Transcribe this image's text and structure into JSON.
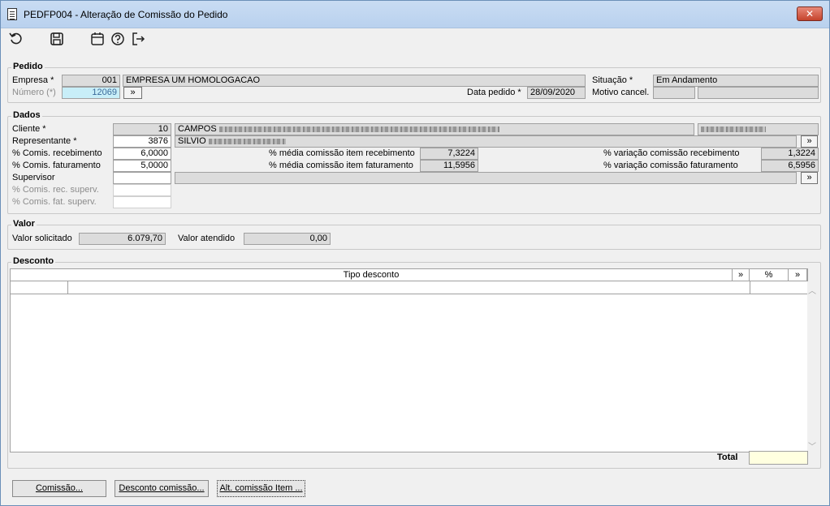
{
  "window": {
    "title": "PEDFP004 - Alteração de Comissão do Pedido",
    "close_label": "✕"
  },
  "toolbar": {
    "undo_icon": "undo-icon",
    "save_icon": "save-icon",
    "calendar_icon": "calendar-icon",
    "help_icon": "help-icon",
    "exit_icon": "exit-icon"
  },
  "pedido": {
    "legend": "Pedido",
    "empresa_label": "Empresa *",
    "empresa_code": "001",
    "empresa_name": "EMPRESA UM HOMOLOGACAO",
    "numero_label": "Número (*)",
    "numero_value": "12069",
    "lookup_label": "»",
    "data_label": "Data pedido *",
    "data_value": "28/09/2020",
    "situacao_label": "Situação *",
    "situacao_value": "Em Andamento",
    "motivo_label": "Motivo cancel."
  },
  "dados": {
    "legend": "Dados",
    "cliente_label": "Cliente *",
    "cliente_code": "10",
    "cliente_name": "CAMPOS",
    "representante_label": "Representante *",
    "representante_code": "3876",
    "representante_name": "SILVIO",
    "comis_receb_label": "% Comis. recebimento",
    "comis_receb_value": "6,0000",
    "comis_fat_label": "% Comis. faturamento",
    "comis_fat_value": "5,0000",
    "supervisor_label": "Supervisor",
    "comis_rec_superv_label": "% Comis. rec. superv.",
    "comis_fat_superv_label": "% Comis. fat. superv.",
    "media_receb_label": "% média comissão item recebimento",
    "media_receb_value": "7,3224",
    "media_fat_label": "% média comissão item faturamento",
    "media_fat_value": "11,5956",
    "var_receb_label": "% variação comissão recebimento",
    "var_receb_value": "1,3224",
    "var_fat_label": "% variação comissão faturamento",
    "var_fat_value": "6,5956",
    "lookup_label": "»"
  },
  "valor": {
    "legend": "Valor",
    "solicitado_label": "Valor solicitado",
    "solicitado_value": "6.079,70",
    "atendido_label": "Valor atendido",
    "atendido_value": "0,00"
  },
  "desconto": {
    "legend": "Desconto",
    "columns": {
      "tipo": "Tipo desconto",
      "tipo_more": "»",
      "pct": "%",
      "pct_more": "»"
    },
    "total_label": "Total",
    "total_value": ""
  },
  "footer": {
    "comissao": "Comissão...",
    "desconto_comissao": "Desconto comissão...",
    "alt_comissao_item": "Alt. comissão Item ..."
  }
}
